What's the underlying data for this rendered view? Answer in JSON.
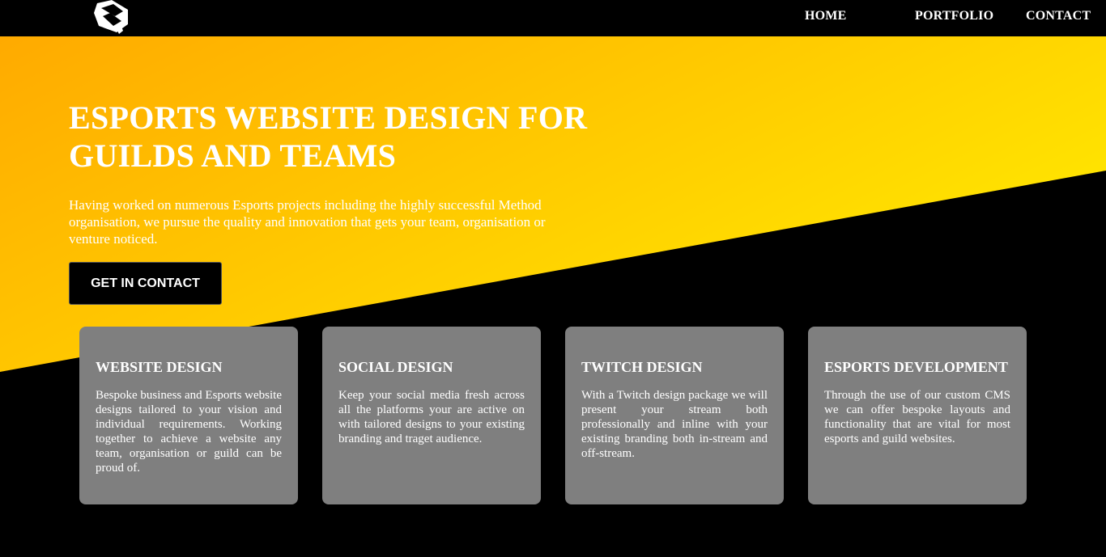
{
  "colors": {
    "gradient_start": "#ffaa00",
    "gradient_end": "#ffe800",
    "background": "#000000",
    "card": "#7f7f7f"
  },
  "header": {
    "logo_icon": "brand-logo-icon",
    "nav": {
      "home": "HOME",
      "portfolio": "PORTFOLIO",
      "contact": "CONTACT"
    }
  },
  "hero": {
    "title": "ESPORTS WEBSITE DESIGN FOR GUILDS AND TEAMS",
    "text": "Having worked on numerous Esports projects including the highly successful Method organisation, we pursue the quality and innovation that gets your team, organisation or venture noticed.",
    "cta_label": "GET IN CONTACT"
  },
  "services": [
    {
      "title": "WEBSITE DESIGN",
      "text": "Bespoke business and Esports website designs tailored to your vision and individual requirements. Working together to achieve a website any team, organisation or guild can be proud of."
    },
    {
      "title": "SOCIAL DESIGN",
      "text": "Keep your social media fresh across all the platforms your are active on with tailored designs to your existing branding and traget audience."
    },
    {
      "title": "TWITCH DESIGN",
      "text": "With a Twitch design package we will present your stream both professionally and inline with your existing branding both in-stream and off-stream."
    },
    {
      "title": "ESPORTS DEVELOPMENT",
      "text": "Through the use of our custom CMS we can offer bespoke layouts and functionality that are vital for most esports and guild websites."
    }
  ]
}
